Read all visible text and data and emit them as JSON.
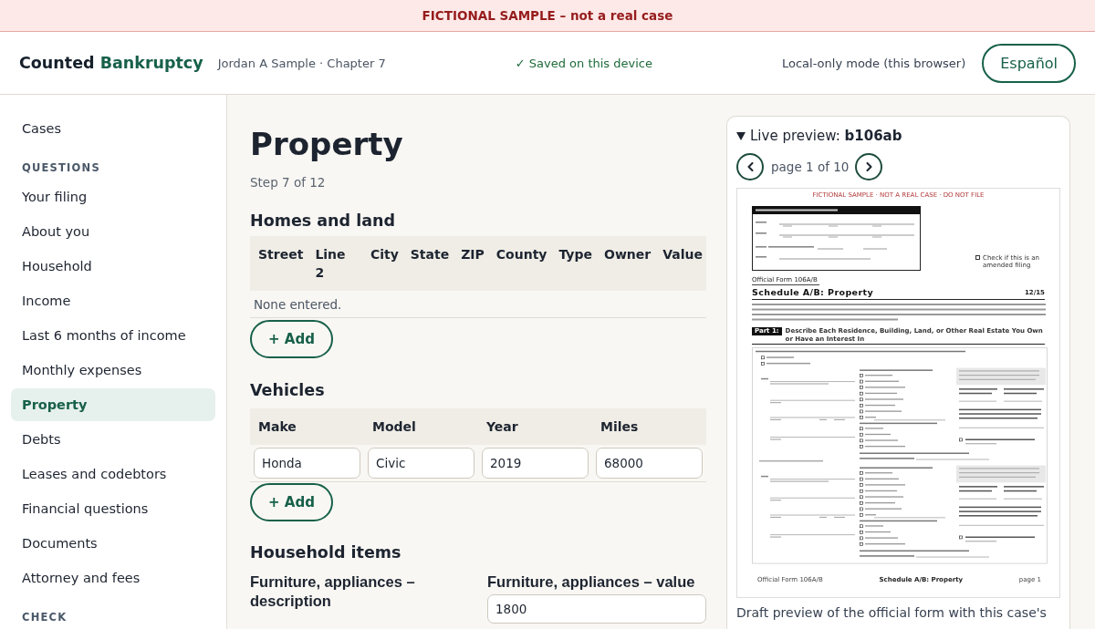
{
  "banner": {
    "text": "FICTIONAL SAMPLE – not a real case"
  },
  "header": {
    "brand": [
      {
        "text": "Counted",
        "kind": "plain"
      },
      {
        "text": "Bankruptcy",
        "kind": "accent"
      }
    ],
    "case_label": "Jordan A Sample · Chapter 7",
    "save_status": "✓ Saved on this device",
    "mode_note": "Local-only mode (this browser)",
    "language_button": "Español"
  },
  "sidebar": {
    "top_items": [
      {
        "label": "Cases",
        "selected": false
      }
    ],
    "sections": [
      {
        "heading": "QUESTIONS",
        "items": [
          {
            "label": "Your filing",
            "selected": false
          },
          {
            "label": "About you",
            "selected": false
          },
          {
            "label": "Household",
            "selected": false
          },
          {
            "label": "Income",
            "selected": false
          },
          {
            "label": "Last 6 months of income",
            "selected": false
          },
          {
            "label": "Monthly expenses",
            "selected": false
          },
          {
            "label": "Property",
            "selected": true
          },
          {
            "label": "Debts",
            "selected": false
          },
          {
            "label": "Leases and codebtors",
            "selected": false
          },
          {
            "label": "Financial questions",
            "selected": false
          },
          {
            "label": "Documents",
            "selected": false
          },
          {
            "label": "Attorney and fees",
            "selected": false
          }
        ]
      },
      {
        "heading": "CHECK"
      }
    ]
  },
  "main": {
    "title": "Property",
    "step": "Step 7 of 12",
    "sections": [
      {
        "kind": "table",
        "heading": "Homes and land",
        "columns": [
          "Street",
          "Line 2",
          "City",
          "State",
          "ZIP",
          "County",
          "Type",
          "Owner",
          "Value"
        ],
        "empty_text": "None entered.",
        "add_button": "+ Add"
      },
      {
        "kind": "table",
        "heading": "Vehicles",
        "columns": [
          "Make",
          "Model",
          "Year",
          "Miles"
        ],
        "rows": [
          [
            "Honda",
            "Civic",
            "2019",
            "68000"
          ]
        ],
        "add_button": "+ Add"
      },
      {
        "kind": "fields",
        "heading": "Household items",
        "fields": [
          {
            "label": "Furniture, appliances – description"
          },
          {
            "label": "Furniture, appliances – value",
            "value": "1800"
          }
        ]
      }
    ]
  },
  "preview": {
    "expanded": true,
    "title": "Live preview: **b106ab**",
    "page_label": "page 1 of 10",
    "form": {
      "top_notice": "FICTIONAL SAMPLE · NOT A REAL CASE · DO NOT FILE",
      "amended_note": "Check if this is an amended filing",
      "form_number": "Official Form 106A/B",
      "title": "Schedule A/B: Property",
      "version": "12/15",
      "part_label": "Part 1:",
      "part_title": "Describe Each Residence, Building, Land, or Other Real Estate You Own or Have an Interest In",
      "footer": [
        "Official Form 106A/B",
        "Schedule A/B: Property",
        "page 1"
      ]
    },
    "caption": "Draft preview of the official form with this case's"
  }
}
